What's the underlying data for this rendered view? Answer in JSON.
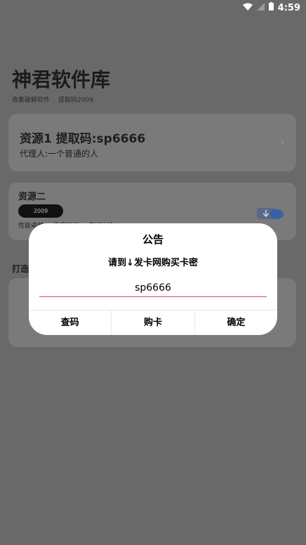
{
  "status_bar": {
    "time": "4:59",
    "icons": [
      "wifi-icon",
      "signal-icon",
      "battery-icon"
    ]
  },
  "header": {
    "title": "神君软件库",
    "subtitle_left": "收集破解软件",
    "subtitle_right": "提取码2009"
  },
  "cards": [
    {
      "title": "资源1    提取码:sp6666",
      "agent": "代理人:一个普通的人",
      "chevron": "›"
    },
    {
      "title": "资源二",
      "pill": "2009",
      "tags": [
        "性能卓越",
        "稳定运行",
        "良好体验"
      ]
    }
  ],
  "section_label": "打造",
  "dialog": {
    "title": "公告",
    "message": "请到↓发卡网购买卡密",
    "input_value": "sp6666",
    "buttons": {
      "query": "查码",
      "buy": "购卡",
      "confirm": "确定"
    }
  }
}
